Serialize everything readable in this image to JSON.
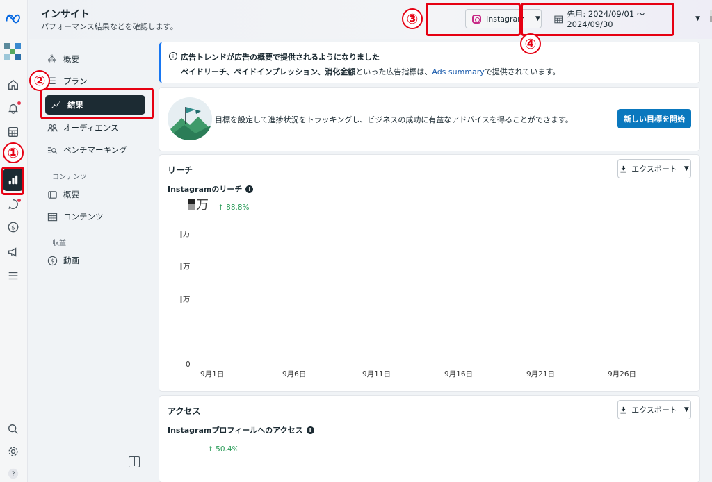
{
  "header": {
    "title": "インサイト",
    "subtitle": "パフォーマンス結果などを確認します。",
    "platform_selector": "Instagram",
    "date_range": "先月: 2024/09/01 ～ 2024/09/30"
  },
  "sidebar": {
    "items": [
      {
        "label": "概要",
        "icon": "network-icon"
      },
      {
        "label": "プラン",
        "icon": "list-icon"
      },
      {
        "label": "結果",
        "icon": "trend-icon"
      },
      {
        "label": "オーディエンス",
        "icon": "people-icon"
      },
      {
        "label": "ベンチマーキング",
        "icon": "benchmark-icon"
      }
    ],
    "section_content": "コンテンツ",
    "content_items": [
      {
        "label": "概要",
        "icon": "cards-icon"
      },
      {
        "label": "コンテンツ",
        "icon": "table-icon"
      }
    ],
    "section_revenue": "収益",
    "revenue_items": [
      {
        "label": "動画",
        "icon": "dollar-icon"
      }
    ]
  },
  "banner": {
    "title": "広告トレンドが広告の概要で提供されるようになりました",
    "body_bold": "ペイドリーチ、ペイドインプレッション、消化金額",
    "body_mid": "といった広告指標は、",
    "link": "Ads summary",
    "body_end": "で提供されています。"
  },
  "goal": {
    "text": "目標を設定して進捗状況をトラッキングし、ビジネスの成功に有益なアドバイスを得ることができます。",
    "button": "新しい目標を開始"
  },
  "reach": {
    "title": "リーチ",
    "export": "エクスポート",
    "metric": "Instagramのリーチ",
    "value_unit": "万",
    "growth": "↑ 88.8%",
    "y_ticks": [
      "万",
      "万",
      "万",
      "0"
    ],
    "x_ticks": [
      "9月1日",
      "9月6日",
      "9月11日",
      "9月16日",
      "9月21日",
      "9月26日"
    ]
  },
  "access": {
    "title": "アクセス",
    "export": "エクスポート",
    "metric": "Instagramプロフィールへのアクセス",
    "growth": "↑ 50.4%"
  },
  "annotations": [
    "①",
    "②",
    "③",
    "④"
  ],
  "colors": {
    "accent_red": "#e60012",
    "primary_blue": "#0a78be",
    "growth_green": "#2d9d5b",
    "dark": "#1c2b33"
  }
}
